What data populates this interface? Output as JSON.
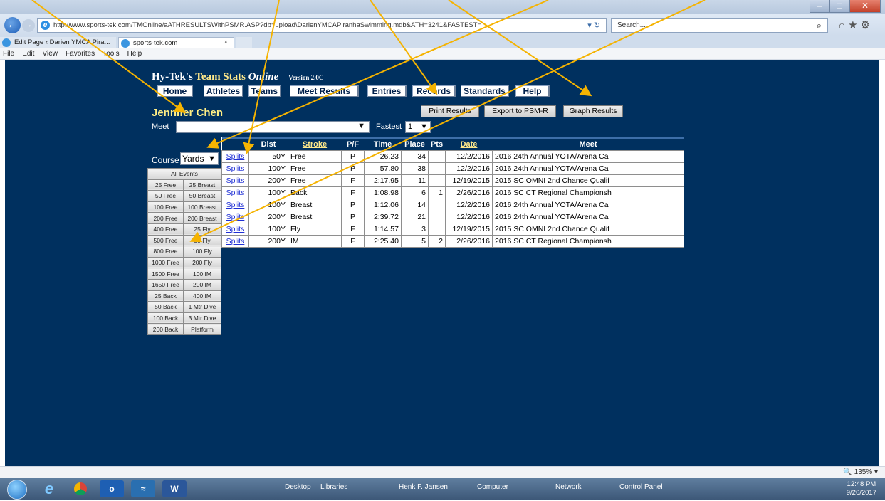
{
  "browser": {
    "address_url": "http://www.sports-tek.com/TMOnline/aATHRESULTSWithPSMR.ASP?db=upload\\DarienYMCAPiranhaSwimming.mdb&ATH=3241&FASTEST=",
    "search_placeholder": "Search...",
    "tabs": [
      {
        "label": "Edit Page ‹ Darien YMCA Pira..."
      },
      {
        "label": "sports-tek.com"
      }
    ],
    "menu": [
      "File",
      "Edit",
      "View",
      "Favorites",
      "Tools",
      "Help"
    ]
  },
  "app": {
    "title_prefix": "Hy-Tek's ",
    "title_main": "Team Stats ",
    "title_online": "Online",
    "version": "Version 2.0C"
  },
  "nav": {
    "home": "Home",
    "athletes": "Athletes",
    "teams": "Teams",
    "meet_results": "Meet Results",
    "entries": "Entries",
    "records": "Records",
    "standards": "Standards",
    "help": "Help"
  },
  "athlete_name": "Jennifer Chen",
  "actions": {
    "print": "Print Results",
    "export": "Export to PSM-R",
    "graph": "Graph Results"
  },
  "filters": {
    "meet_label": "Meet",
    "meet_value": "",
    "fastest_label": "Fastest",
    "fastest_value": "1",
    "course_label": "Course",
    "course_value": "Yards"
  },
  "events": {
    "all": "All Events",
    "grid": [
      [
        "25 Free",
        "25 Breast"
      ],
      [
        "50 Free",
        "50 Breast"
      ],
      [
        "100 Free",
        "100 Breast"
      ],
      [
        "200 Free",
        "200 Breast"
      ],
      [
        "400 Free",
        "25 Fly"
      ],
      [
        "500 Free",
        "50 Fly"
      ],
      [
        "800 Free",
        "100 Fly"
      ],
      [
        "1000 Free",
        "200 Fly"
      ],
      [
        "1500 Free",
        "100 IM"
      ],
      [
        "1650 Free",
        "200 IM"
      ],
      [
        "25 Back",
        "400 IM"
      ],
      [
        "50 Back",
        "1 Mtr Dive"
      ],
      [
        "100 Back",
        "3 Mtr Dive"
      ],
      [
        "200 Back",
        "Platform"
      ]
    ]
  },
  "results": {
    "headers": {
      "dist": "Dist",
      "stroke": "Stroke",
      "pf": "P/F",
      "time": "Time",
      "place": "Place",
      "pts": "Pts",
      "date": "Date",
      "meet": "Meet"
    },
    "rows": [
      {
        "link": "Splits",
        "dist": "50Y",
        "stroke": "Free",
        "pf": "P",
        "time": "26.23",
        "place": "34",
        "pts": "",
        "date": "12/2/2016",
        "meet": "2016 24th Annual YOTA/Arena Ca"
      },
      {
        "link": "Splits",
        "dist": "100Y",
        "stroke": "Free",
        "pf": "P",
        "time": "57.80",
        "place": "38",
        "pts": "",
        "date": "12/2/2016",
        "meet": "2016 24th Annual YOTA/Arena Ca"
      },
      {
        "link": "Splits",
        "dist": "200Y",
        "stroke": "Free",
        "pf": "F",
        "time": "2:17.95",
        "place": "11",
        "pts": "",
        "date": "12/19/2015",
        "meet": "2015 SC OMNI 2nd Chance Qualif"
      },
      {
        "link": "Splits",
        "dist": "100Y",
        "stroke": "Back",
        "pf": "F",
        "time": "1:08.98",
        "place": "6",
        "pts": "1",
        "date": "2/26/2016",
        "meet": "2016 SC CT Regional Championsh"
      },
      {
        "link": "Splits",
        "dist": "100Y",
        "stroke": "Breast",
        "pf": "P",
        "time": "1:12.06",
        "place": "14",
        "pts": "",
        "date": "12/2/2016",
        "meet": "2016 24th Annual YOTA/Arena Ca"
      },
      {
        "link": "Splits",
        "dist": "200Y",
        "stroke": "Breast",
        "pf": "P",
        "time": "2:39.72",
        "place": "21",
        "pts": "",
        "date": "12/2/2016",
        "meet": "2016 24th Annual YOTA/Arena Ca"
      },
      {
        "link": "Splits",
        "dist": "100Y",
        "stroke": "Fly",
        "pf": "F",
        "time": "1:14.57",
        "place": "3",
        "pts": "",
        "date": "12/19/2015",
        "meet": "2015 SC OMNI 2nd Chance Qualif"
      },
      {
        "link": "Splits",
        "dist": "200Y",
        "stroke": "IM",
        "pf": "F",
        "time": "2:25.40",
        "place": "5",
        "pts": "2",
        "date": "2/26/2016",
        "meet": "2016 SC CT Regional Championsh"
      }
    ]
  },
  "status": {
    "zoom": "135%"
  },
  "taskbar": {
    "items": [
      "Desktop",
      "Libraries",
      "Henk F. Jansen",
      "Computer",
      "Network",
      "Control Panel"
    ],
    "time": "12:48 PM",
    "date": "9/26/2017"
  },
  "colors": {
    "page_bg": "#00305f",
    "title_yellow": "#ffe98a",
    "arrow": "#f5b301",
    "link": "#1f2fd5"
  }
}
